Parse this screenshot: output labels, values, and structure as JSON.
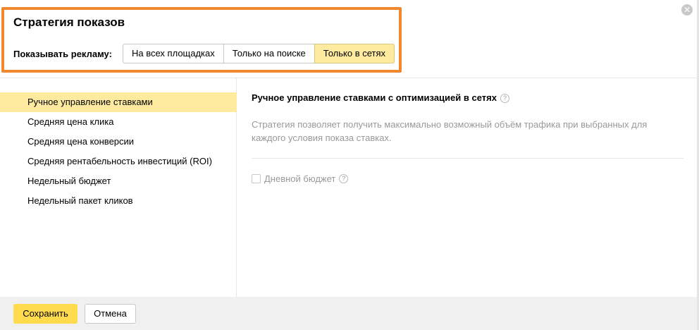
{
  "dialog": {
    "title": "Стратегия показов",
    "close_icon": "close-icon"
  },
  "ad_display": {
    "label": "Показывать рекламу:",
    "options": [
      "На всех площадках",
      "Только на поиске",
      "Только в сетях"
    ],
    "selected": "Только в сетях"
  },
  "sidebar": {
    "items": [
      {
        "label": "Ручное управление ставками",
        "active": true
      },
      {
        "label": "Средняя цена клика",
        "active": false
      },
      {
        "label": "Средняя цена конверсии",
        "active": false
      },
      {
        "label": "Средняя рентабельность инвестиций (ROI)",
        "active": false
      },
      {
        "label": "Недельный бюджет",
        "active": false
      },
      {
        "label": "Недельный пакет кликов",
        "active": false
      }
    ]
  },
  "content": {
    "title": "Ручное управление ставками с оптимизацией в сетях",
    "help_icon": "?",
    "description": "Стратегия позволяет получить максимально возможный объём трафика при выбранных для каждого условия показа ставках.",
    "daily_budget_label": "Дневной бюджет",
    "daily_budget_help": "?"
  },
  "footer": {
    "save_label": "Сохранить",
    "cancel_label": "Отмена"
  },
  "colors": {
    "accent_yellow": "#ffdb4d",
    "selected_bg": "#ffeba0",
    "highlight_border": "#f0882f"
  }
}
